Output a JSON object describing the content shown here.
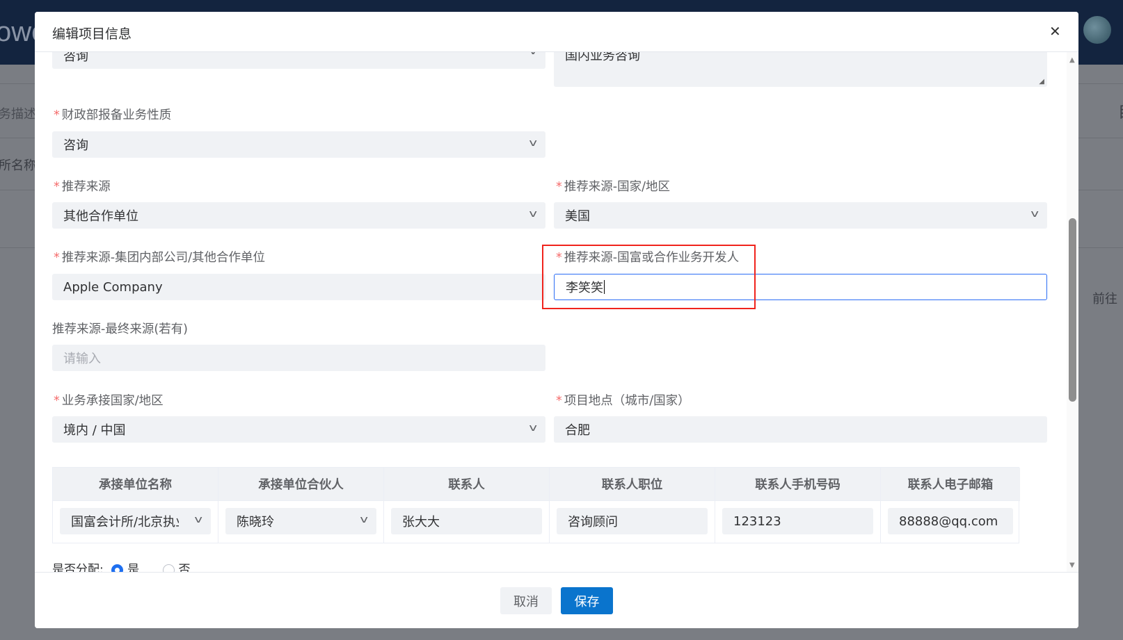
{
  "background": {
    "logo_text": "owe",
    "desc_label": "务描述",
    "name_label": "所名称",
    "goto_label": "前往",
    "right_letter": "目"
  },
  "modal": {
    "title": "编辑项目信息",
    "close_icon": "close-icon",
    "top_select_value": "咨询",
    "top_textarea_value": "国内业务咨询",
    "fields": {
      "mof_nature": {
        "label": "财政部报备业务性质",
        "value": "咨询",
        "required": true
      },
      "source": {
        "label": "推荐来源",
        "value": "其他合作单位",
        "required": true
      },
      "source_country": {
        "label": "推荐来源-国家/地区",
        "value": "美国",
        "required": true
      },
      "source_unit": {
        "label": "推荐来源-集团内部公司/其他合作单位",
        "value": "Apple Company",
        "required": true
      },
      "source_developer": {
        "label": "推荐来源-国富或合作业务开发人",
        "value": "李笑笑",
        "required": true
      },
      "final_source": {
        "label": "推荐来源-最终来源(若有)",
        "placeholder": "请输入",
        "required": false
      },
      "undertake_country": {
        "label": "业务承接国家/地区",
        "value": "境内 / 中国",
        "required": true
      },
      "project_location": {
        "label": "项目地点（城市/国家）",
        "value": "合肥",
        "required": true
      }
    },
    "table": {
      "headers": [
        "承接单位名称",
        "承接单位合伙人",
        "联系人",
        "联系人职位",
        "联系人手机号码",
        "联系人电子邮箱"
      ],
      "row": [
        "国富会计所/北京执业",
        "陈晓玲",
        "张大大",
        "咨询顾问",
        "123123",
        "88888@qq.com"
      ]
    },
    "allocate": {
      "label": "是否分配:",
      "yes": "是",
      "no": "否",
      "selected": "是"
    },
    "footer": {
      "cancel": "取消",
      "save": "保存"
    },
    "colors": {
      "primary": "#0a74cd",
      "focus": "#2a6cf5",
      "highlight": "#f0231c",
      "required": "#f56c6c"
    }
  }
}
